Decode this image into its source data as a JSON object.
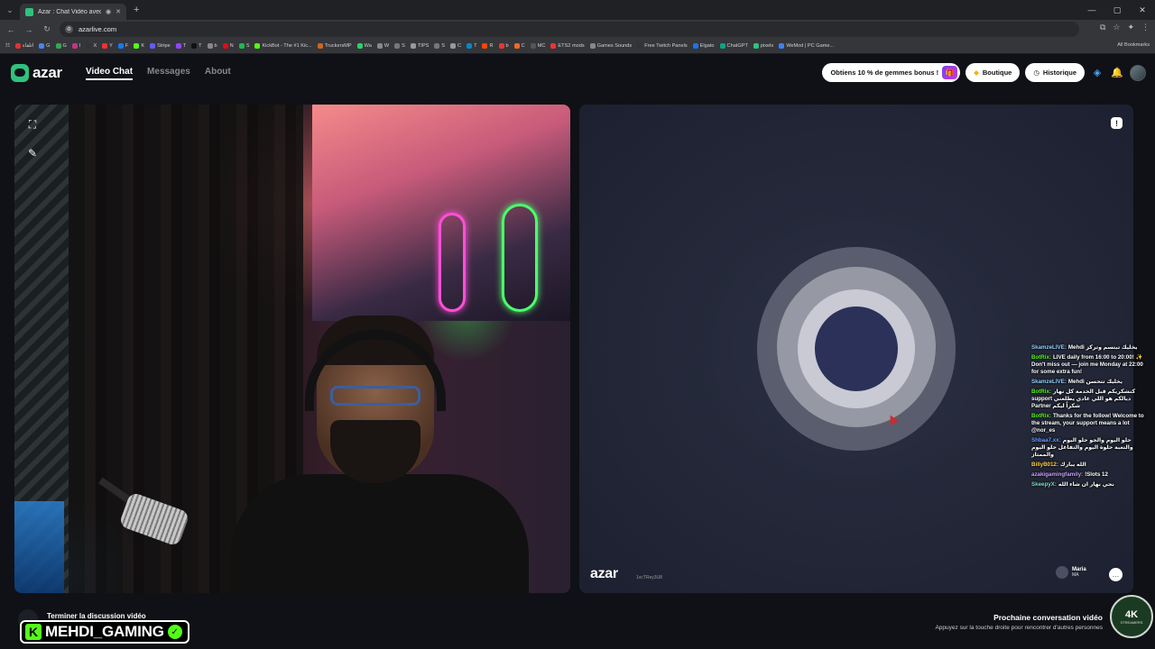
{
  "browser": {
    "tab_title": "Azar : Chat Vidéo avec de",
    "url": "azarlive.com",
    "bookmarks": [
      {
        "label": "اتلقاء",
        "color": "#d33"
      },
      {
        "label": "G",
        "color": "#4285f4"
      },
      {
        "label": "G",
        "color": "#34a853"
      },
      {
        "label": "I",
        "color": "#c13584"
      },
      {
        "label": "X",
        "color": "#333"
      },
      {
        "label": "Y",
        "color": "#e33"
      },
      {
        "label": "F",
        "color": "#1877f2"
      },
      {
        "label": "K",
        "color": "#53fc18"
      },
      {
        "label": "Stripe",
        "color": "#635bff"
      },
      {
        "label": "T",
        "color": "#9146ff"
      },
      {
        "label": "T",
        "color": "#111"
      },
      {
        "label": "b",
        "color": "#888"
      },
      {
        "label": "N",
        "color": "#e50914"
      },
      {
        "label": "S",
        "color": "#1db954"
      },
      {
        "label": "KickBot - The #1 Kic...",
        "color": "#53fc18"
      },
      {
        "label": "TruckersMP",
        "color": "#c62"
      },
      {
        "label": "Wa",
        "color": "#25d366"
      },
      {
        "label": "W",
        "color": "#888"
      },
      {
        "label": "S",
        "color": "#777"
      },
      {
        "label": "TIPS",
        "color": "#999"
      },
      {
        "label": "S",
        "color": "#777"
      },
      {
        "label": "C",
        "color": "#999"
      },
      {
        "label": "T",
        "color": "#0088cc"
      },
      {
        "label": "R",
        "color": "#ff4500"
      },
      {
        "label": "b",
        "color": "#e33"
      },
      {
        "label": "C",
        "color": "#f26822"
      },
      {
        "label": "MC",
        "color": "#555"
      },
      {
        "label": "ETS2 mods",
        "color": "#e33"
      },
      {
        "label": "Games Sounds",
        "color": "#888"
      },
      {
        "label": "Free Twitch Panels",
        "color": "#333"
      },
      {
        "label": "Elgato",
        "color": "#1a73e8"
      },
      {
        "label": "ChatGPT",
        "color": "#10a37f"
      },
      {
        "label": "pixels",
        "color": "#2ec27e"
      },
      {
        "label": "WeMod | PC Game...",
        "color": "#3b82f6"
      }
    ],
    "all_bookmarks": "All Bookmarks"
  },
  "header": {
    "logo": "azar",
    "nav": [
      "Video Chat",
      "Messages",
      "About"
    ],
    "gems_promo": "Obtiens 10 % de gemmes bonus !",
    "shop": "Boutique",
    "history": "Historique"
  },
  "right_pane": {
    "watermark": "azar",
    "watermark_id": "1vcTRey3U8",
    "peer_name": "Maria",
    "peer_country": "MA"
  },
  "stream_chat": [
    {
      "user": "SkamzeLIVE:",
      "user_color": "#8fd3ff",
      "text": "Mehdi يخليك تبتسم وتركز"
    },
    {
      "user": "BotRix:",
      "user_color": "#53fc18",
      "text": "LIVE daily from 16:00 to 20:00! ✨ Don't miss out — join me Monday at 22:00 for some extra fun!"
    },
    {
      "user": "SkamzeLIVE:",
      "user_color": "#8fd3ff",
      "text": "Mehdi يخليك تتحسن"
    },
    {
      "user": "BotRix:",
      "user_color": "#53fc18",
      "text": "كنشكريكم قبل الخدمة كل نهار support ديالكم هو اللي عادي يطلعني Partner شكراً ليكم"
    },
    {
      "user": "BotRix:",
      "user_color": "#53fc18",
      "text": "Thanks for the follow! Welcome to the stream, your support means a lot @nor_es"
    },
    {
      "user": "Shbaa7.xx:",
      "user_color": "#6aa0ff",
      "text": "حلو اليوم والجو حلو اليوم والتعبة حلوة اليوم والتفاعل حلو اليوم والممتاز"
    },
    {
      "user": "BillyB012:",
      "user_color": "#ffd24a",
      "text": "الله يبارك"
    },
    {
      "user": "azakigamingfamily:",
      "user_color": "#c9a0ff",
      "text": "!Slots 12"
    },
    {
      "user": "SkeepyX:",
      "user_color": "#7ae0c8",
      "text": "نحي نهار ان شاء الله"
    }
  ],
  "footer": {
    "end_label": "Terminer la discussion vidéo",
    "streamer": "MEHDI_GAMING",
    "next_title": "Prochaine conversation vidéo",
    "next_sub": "Appuyez sur la touche droite pour rencontrer d'autres personnes",
    "badge_main": "4K",
    "badge_sub": "STREAMERS"
  }
}
